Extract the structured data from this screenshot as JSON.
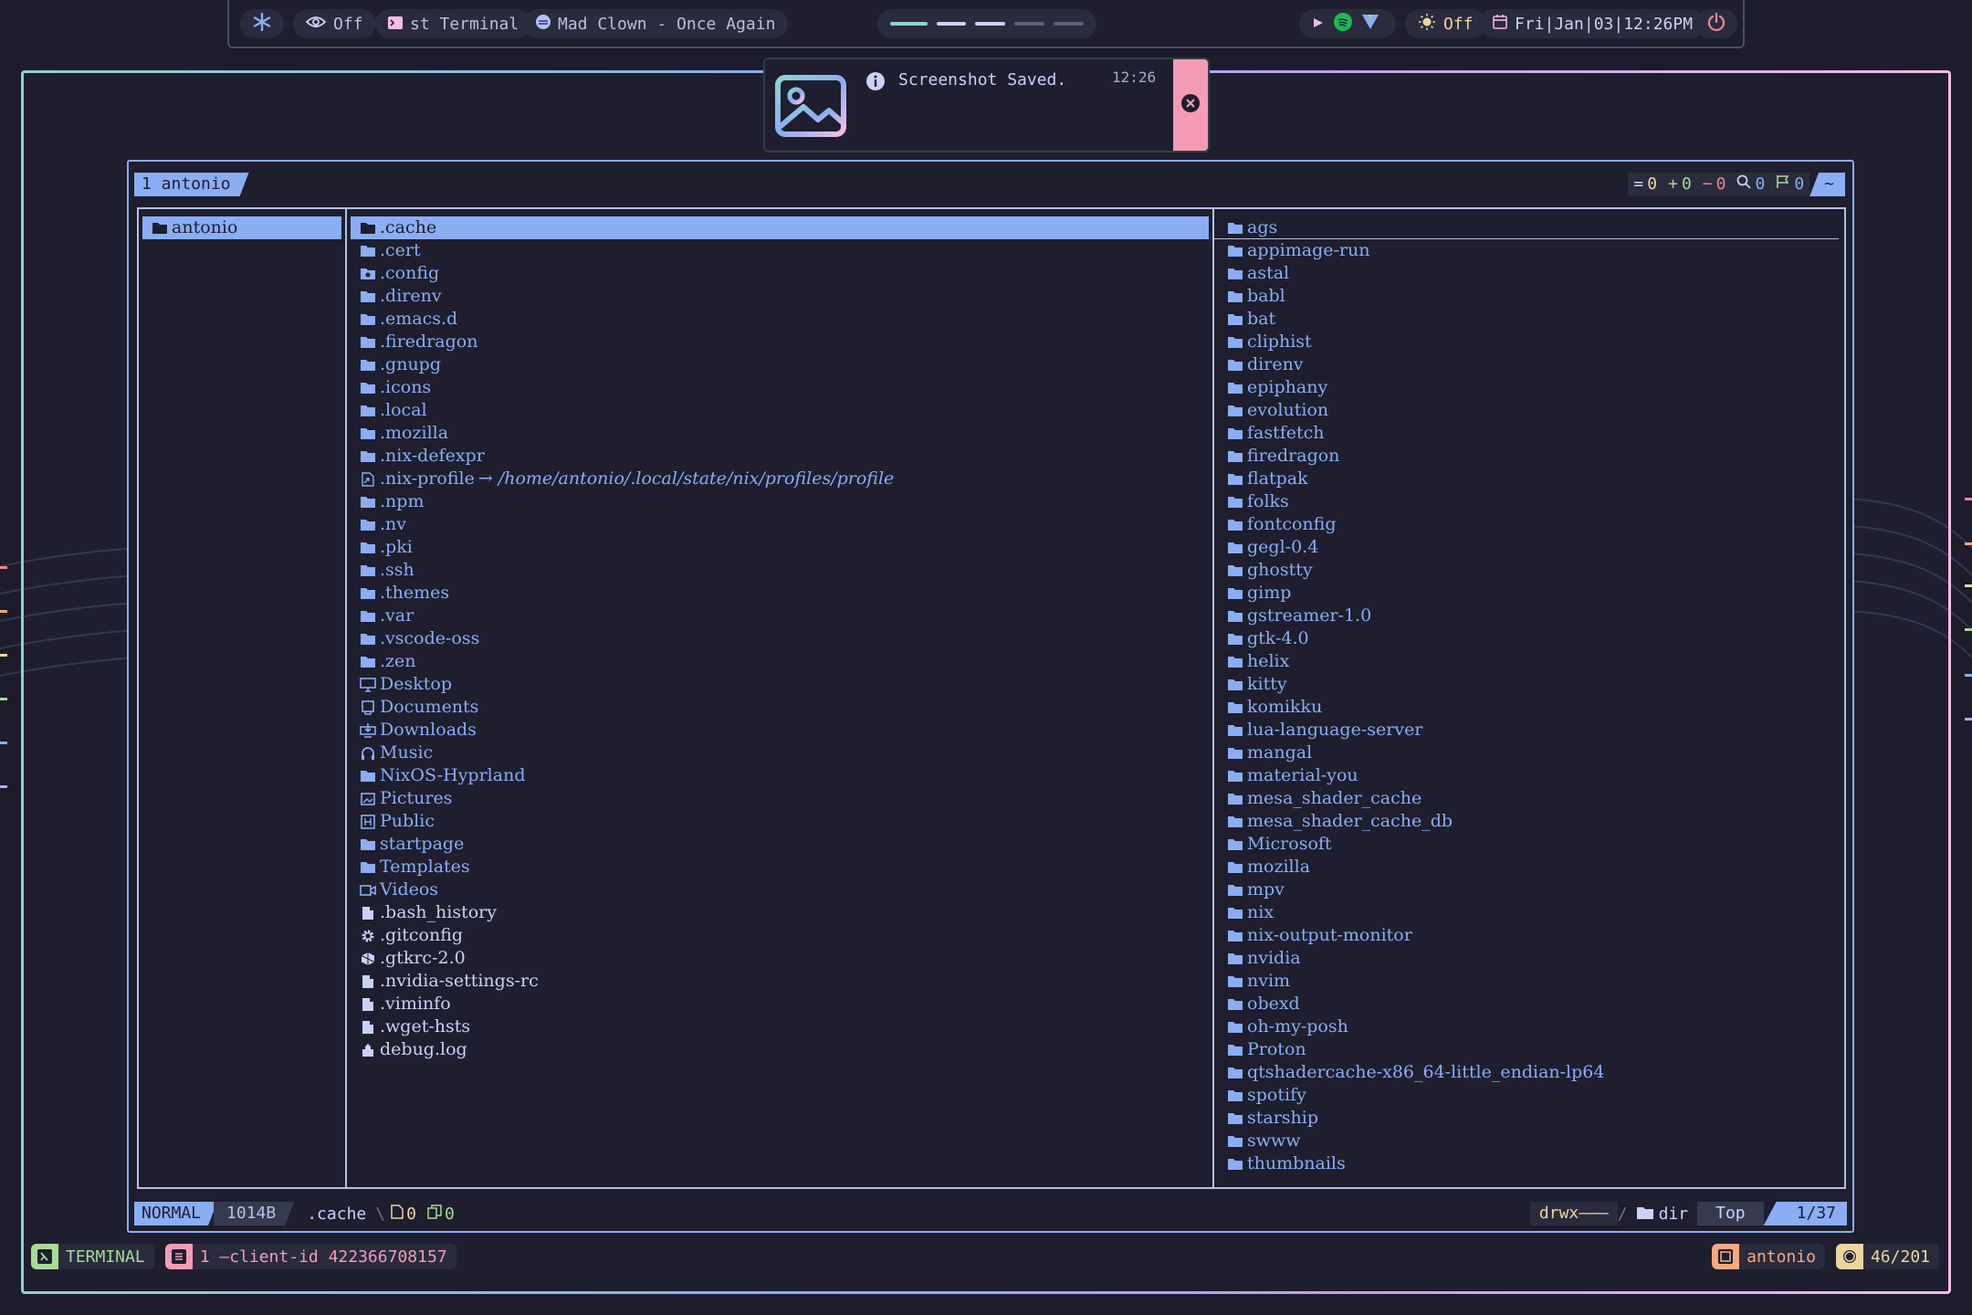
{
  "topbar": {
    "idle_inhibit_state": "Off",
    "window_title": "st Terminal",
    "media_title": "Mad Clown - Once Again",
    "night_light_state": "Off",
    "datetime": "Fri|Jan|03|12:26PM"
  },
  "notification": {
    "message": "Screenshot Saved.",
    "time": "12:26"
  },
  "yazi": {
    "tab": "1 antonio",
    "counters": {
      "unchanged": "0",
      "added": "0",
      "removed": "0",
      "search": "0",
      "flagged": "0",
      "home": "~"
    },
    "parent": [
      "antonio"
    ],
    "current": [
      {
        "name": ".cache",
        "icon": "folder"
      },
      {
        "name": ".cert",
        "icon": "folder"
      },
      {
        "name": ".config",
        "icon": "config-folder"
      },
      {
        "name": ".direnv",
        "icon": "folder"
      },
      {
        "name": ".emacs.d",
        "icon": "folder"
      },
      {
        "name": ".firedragon",
        "icon": "folder"
      },
      {
        "name": ".gnupg",
        "icon": "folder"
      },
      {
        "name": ".icons",
        "icon": "folder"
      },
      {
        "name": ".local",
        "icon": "folder"
      },
      {
        "name": ".mozilla",
        "icon": "folder"
      },
      {
        "name": ".nix-defexpr",
        "icon": "folder"
      },
      {
        "name": ".nix-profile",
        "icon": "symlink",
        "target": "→ /home/antonio/.local/state/nix/profiles/profile"
      },
      {
        "name": ".npm",
        "icon": "folder"
      },
      {
        "name": ".nv",
        "icon": "folder"
      },
      {
        "name": ".pki",
        "icon": "folder"
      },
      {
        "name": ".ssh",
        "icon": "folder"
      },
      {
        "name": ".themes",
        "icon": "folder"
      },
      {
        "name": ".var",
        "icon": "folder"
      },
      {
        "name": ".vscode-oss",
        "icon": "folder"
      },
      {
        "name": ".zen",
        "icon": "folder"
      },
      {
        "name": "Desktop",
        "icon": "desktop"
      },
      {
        "name": "Documents",
        "icon": "documents"
      },
      {
        "name": "Downloads",
        "icon": "downloads"
      },
      {
        "name": "Music",
        "icon": "music"
      },
      {
        "name": "NixOS-Hyprland",
        "icon": "folder"
      },
      {
        "name": "Pictures",
        "icon": "pictures"
      },
      {
        "name": "Public",
        "icon": "public"
      },
      {
        "name": "startpage",
        "icon": "folder"
      },
      {
        "name": "Templates",
        "icon": "folder"
      },
      {
        "name": "Videos",
        "icon": "videos"
      },
      {
        "name": ".bash_history",
        "icon": "file"
      },
      {
        "name": ".gitconfig",
        "icon": "gear"
      },
      {
        "name": ".gtkrc-2.0",
        "icon": "gtk"
      },
      {
        "name": ".nvidia-settings-rc",
        "icon": "file"
      },
      {
        "name": ".viminfo",
        "icon": "file"
      },
      {
        "name": ".wget-hsts",
        "icon": "file"
      },
      {
        "name": "debug.log",
        "icon": "log"
      }
    ],
    "preview": [
      "ags",
      "appimage-run",
      "astal",
      "babl",
      "bat",
      "cliphist",
      "direnv",
      "epiphany",
      "evolution",
      "fastfetch",
      "firedragon",
      "flatpak",
      "folks",
      "fontconfig",
      "gegl-0.4",
      "ghostty",
      "gimp",
      "gstreamer-1.0",
      "gtk-4.0",
      "helix",
      "kitty",
      "komikku",
      "lua-language-server",
      "mangal",
      "material-you",
      "mesa_shader_cache",
      "mesa_shader_cache_db",
      "Microsoft",
      "mozilla",
      "mpv",
      "nix",
      "nix-output-monitor",
      "nvidia",
      "nvim",
      "obexd",
      "oh-my-posh",
      "Proton",
      "qtshadercache-x86_64-little_endian-lp64",
      "spotify",
      "starship",
      "swww",
      "thumbnails"
    ],
    "status": {
      "mode": "NORMAL",
      "size": "1014B",
      "name": ".cache",
      "files_count": "0",
      "copied_count": "0",
      "permissions": "drwx———",
      "filetype": "dir",
      "position": "Top",
      "index": "1/37"
    }
  },
  "bottombar": {
    "mode": "TERMINAL",
    "session": "1 —client-id 422366708157",
    "user": "antonio",
    "count": "46/201"
  },
  "colors": {
    "accent": "#8aadf4",
    "bg": "#1e1e2e",
    "pink": "#f49cb5",
    "green": "#a6da95",
    "yellow": "#eed49f"
  }
}
